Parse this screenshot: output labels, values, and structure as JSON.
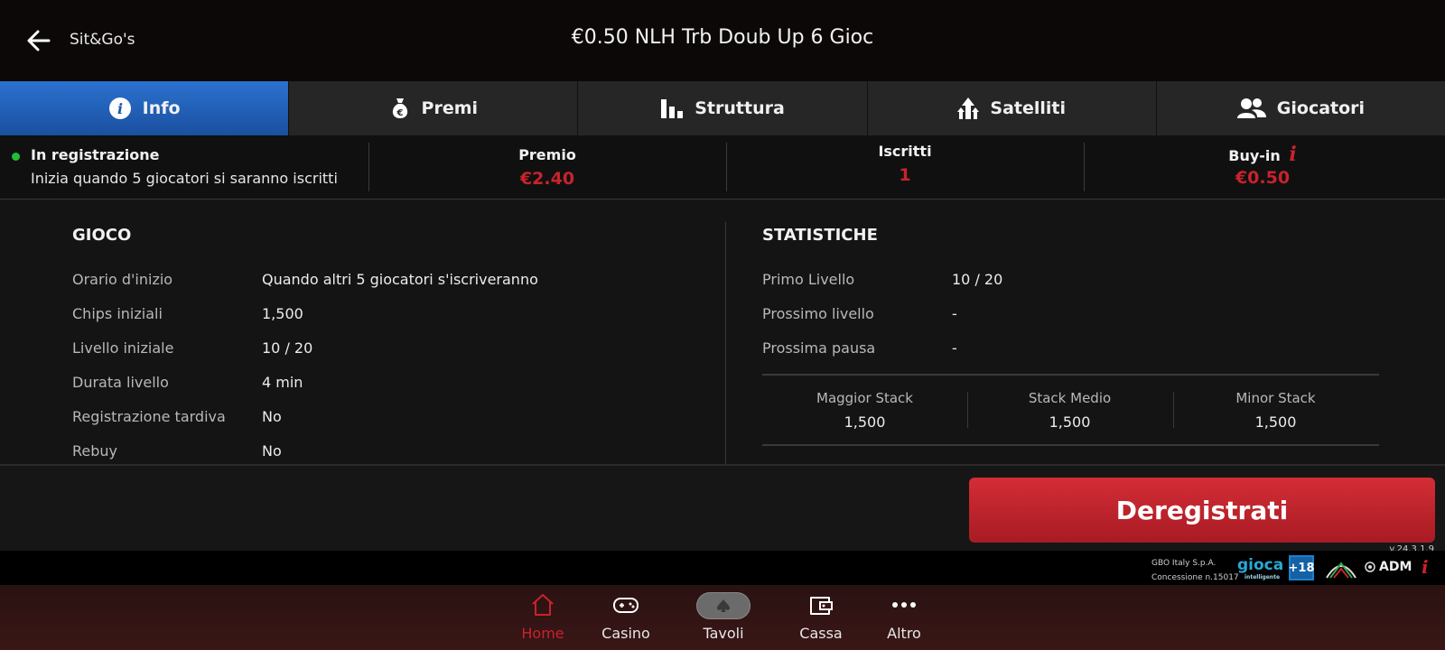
{
  "header": {
    "back_label": "Sit&Go's",
    "title": "€0.50 NLH Trb Doub Up 6 Gioc"
  },
  "tabs": [
    {
      "label": "Info",
      "icon": "info-icon",
      "active": true
    },
    {
      "label": "Premi",
      "icon": "money-bag-icon",
      "active": false
    },
    {
      "label": "Struttura",
      "icon": "bar-chart-icon",
      "active": false
    },
    {
      "label": "Satelliti",
      "icon": "arrows-up-icon",
      "active": false
    },
    {
      "label": "Giocatori",
      "icon": "users-icon",
      "active": false
    }
  ],
  "summary": {
    "status": "In registrazione",
    "status_sub": "Inizia quando 5 giocatori si saranno iscritti",
    "status_color": "#1fbf3a",
    "prize_label": "Premio",
    "prize_value": "€2.40",
    "entrants_label": "Iscritti",
    "entrants_value": "1",
    "buyin_label": "Buy-in",
    "buyin_value": "€0.50",
    "accent_color": "#c8232c"
  },
  "game": {
    "title": "GIOCO",
    "rows": [
      {
        "label": "Orario d'inizio",
        "value": "Quando altri 5 giocatori s'iscriveranno"
      },
      {
        "label": "Chips iniziali",
        "value": "1,500"
      },
      {
        "label": "Livello iniziale",
        "value": "10 / 20"
      },
      {
        "label": "Durata livello",
        "value": "4 min"
      },
      {
        "label": "Registrazione tardiva",
        "value": "No"
      },
      {
        "label": "Rebuy",
        "value": "No"
      }
    ]
  },
  "stats": {
    "title": "STATISTICHE",
    "rows": [
      {
        "label": "Primo Livello",
        "value": "10 / 20"
      },
      {
        "label": "Prossimo livello",
        "value": "-"
      },
      {
        "label": "Prossima pausa",
        "value": "-"
      }
    ],
    "stacks": [
      {
        "label": "Maggior Stack",
        "value": "1,500"
      },
      {
        "label": "Stack Medio",
        "value": "1,500"
      },
      {
        "label": "Minor Stack",
        "value": "1,500"
      }
    ]
  },
  "action": {
    "deregister_label": "Deregistrati",
    "version": "v.24.3.1.9"
  },
  "legal": {
    "company": "GBO Italy S.p.A.",
    "concession": "Concessione n.15017",
    "gioca": "gioca",
    "gioca_sub": "intelligente",
    "age": "+18",
    "adm": "ADM"
  },
  "nav": [
    {
      "label": "Home",
      "icon": "home-icon",
      "active": true
    },
    {
      "label": "Casino",
      "icon": "gamepad-icon",
      "active": false
    },
    {
      "label": "Tavoli",
      "icon": "spade-icon",
      "active": false
    },
    {
      "label": "Cassa",
      "icon": "wallet-icon",
      "active": false
    },
    {
      "label": "Altro",
      "icon": "more-icon",
      "active": false
    }
  ]
}
